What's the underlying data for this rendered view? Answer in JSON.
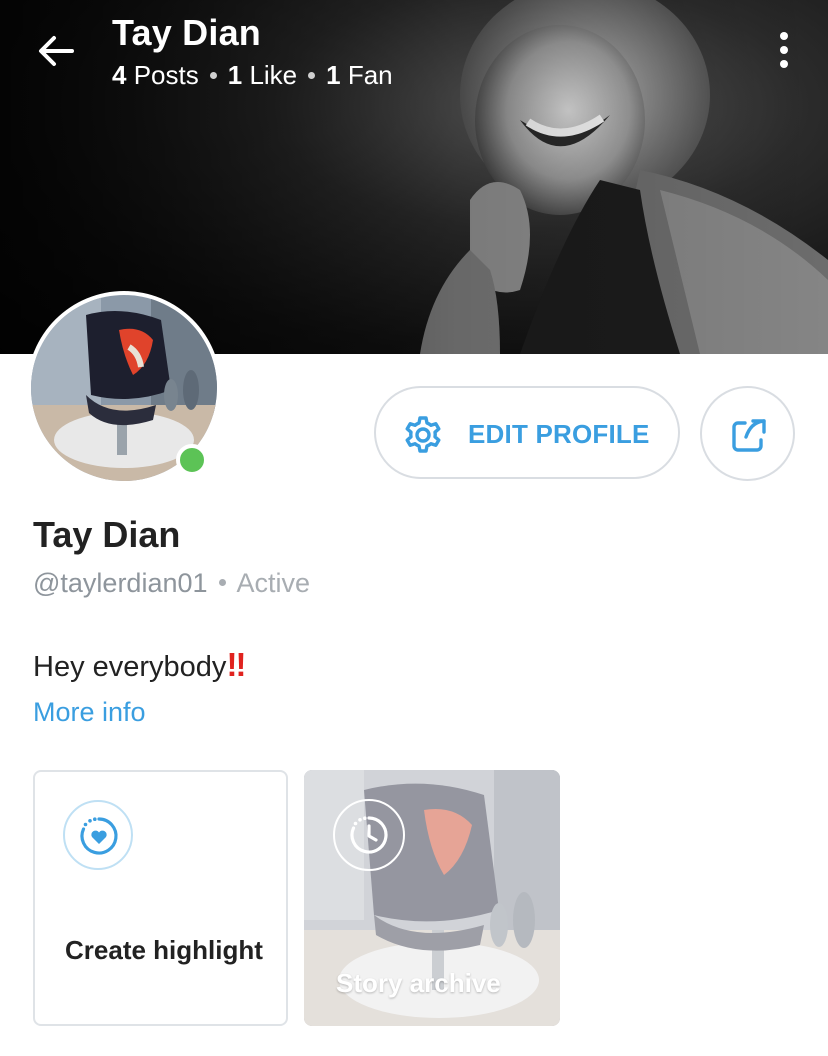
{
  "header": {
    "title": "Tay Dian",
    "posts_count": "4",
    "posts_label": "Posts",
    "likes_count": "1",
    "likes_label": "Like",
    "fans_count": "1",
    "fans_label": "Fan",
    "back_icon": "arrow-left-icon",
    "more_icon": "more-vertical-icon"
  },
  "profile": {
    "name": "Tay Dian",
    "handle": "@taylerdian01",
    "status": "Active",
    "bio": "Hey everybody",
    "bio_emoji": "‼",
    "more_info_label": "More info",
    "online": true
  },
  "actions": {
    "edit_profile_label": "EDIT PROFILE",
    "edit_icon": "gear-icon",
    "share_icon": "share-icon"
  },
  "highlights": [
    {
      "label": "Create highlight",
      "icon": "heart-circle-icon"
    },
    {
      "label": "Story archive",
      "icon": "clock-history-icon"
    }
  ],
  "colors": {
    "accent": "#3a9ee0",
    "online": "#5cc356",
    "bang": "#e0231f",
    "muted": "#8e959c"
  }
}
